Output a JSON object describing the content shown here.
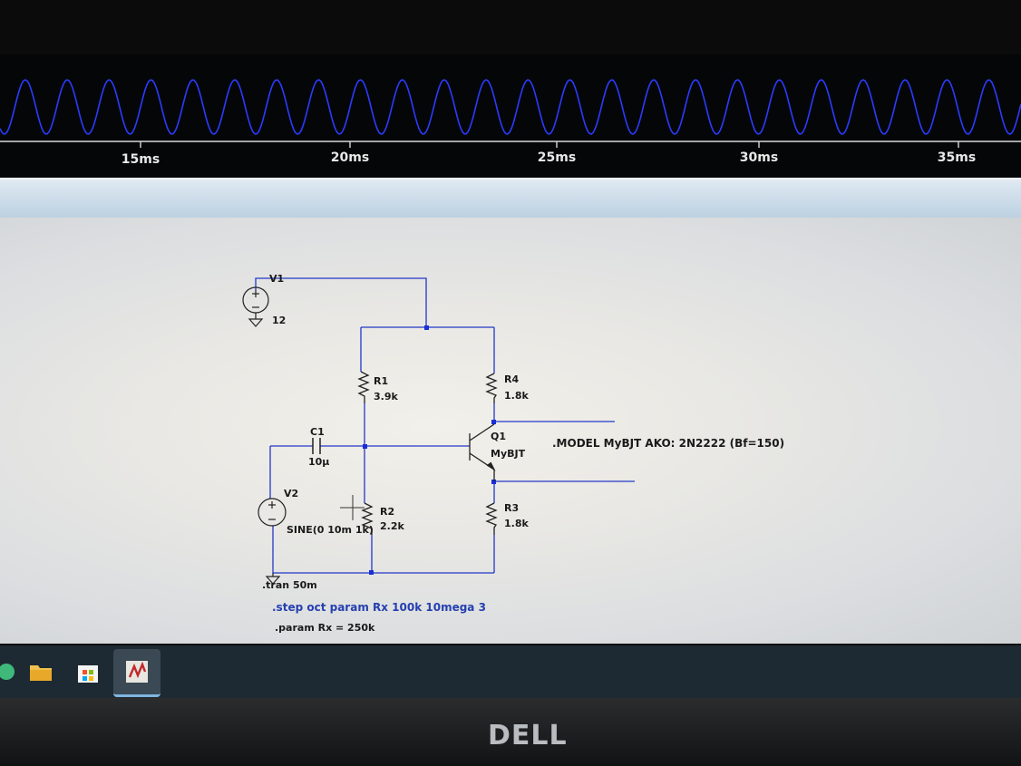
{
  "waveform": {
    "color": "#2a3cff",
    "axis_ticks": [
      {
        "label": "15ms"
      },
      {
        "label": "20ms"
      },
      {
        "label": "25ms"
      },
      {
        "label": "30ms"
      },
      {
        "label": "35ms"
      }
    ]
  },
  "schematic": {
    "wire_color": "#2338c8",
    "components": {
      "v1": {
        "name": "V1",
        "value": "12"
      },
      "r1": {
        "name": "R1",
        "value": "3.9k"
      },
      "r4": {
        "name": "R4",
        "value": "1.8k"
      },
      "c1": {
        "name": "C1",
        "value": "10µ"
      },
      "q1": {
        "name": "Q1",
        "value": "MyBJT"
      },
      "v2": {
        "name": "V2",
        "value": "SINE(0 10m 1k)"
      },
      "r2": {
        "name": "R2",
        "value": "2.2k"
      },
      "r3": {
        "name": "R3",
        "value": "1.8k"
      }
    },
    "directives": {
      "model": ".MODEL MyBJT AKO: 2N2222 (Bf=150)",
      "tran": ".tran 50m",
      "step": ".step oct param Rx 100k 10mega 3",
      "param": ".param Rx = 250k"
    }
  },
  "taskbar": {
    "icons": [
      "file-explorer-icon",
      "store-icon",
      "ltspice-icon"
    ]
  },
  "monitor": {
    "brand": "DELL"
  }
}
